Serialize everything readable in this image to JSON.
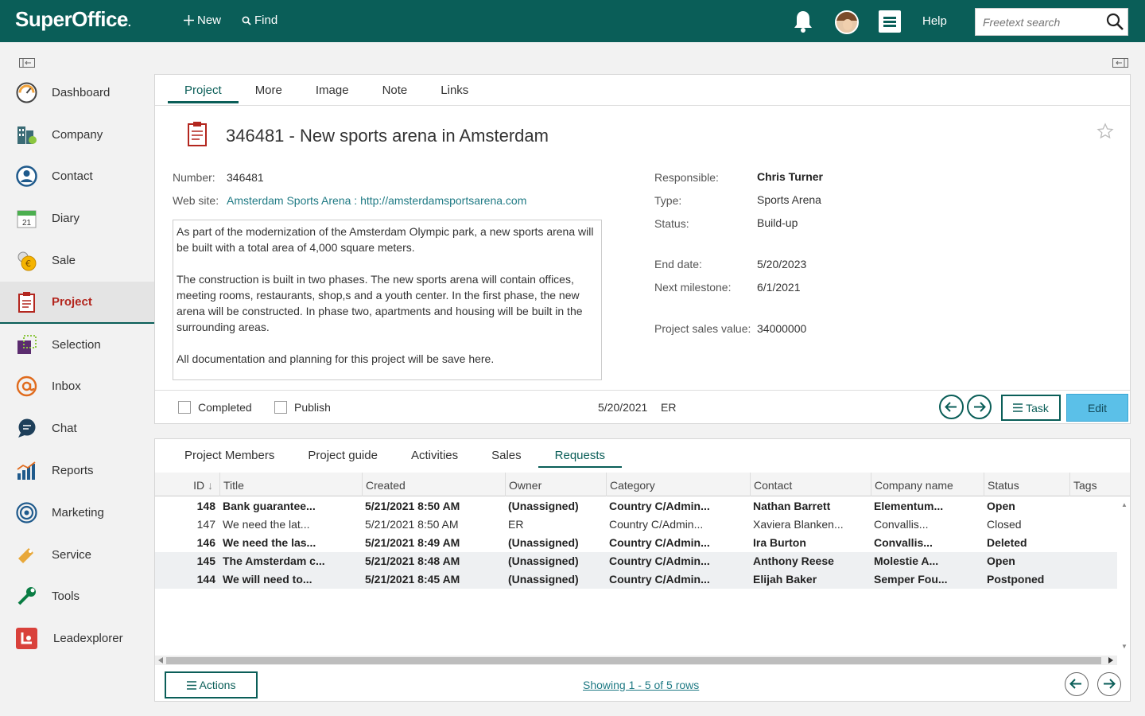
{
  "topbar": {
    "logo": "SuperOffice",
    "logo_dot": ".",
    "new_label": "New",
    "find_label": "Find",
    "help_label": "Help",
    "search_placeholder": "Freetext search",
    "brand_color": "#0a5e58"
  },
  "sidebar": {
    "items": [
      {
        "label": "Dashboard",
        "icon": "dashboard-icon"
      },
      {
        "label": "Company",
        "icon": "company-icon"
      },
      {
        "label": "Contact",
        "icon": "contact-icon"
      },
      {
        "label": "Diary",
        "icon": "diary-icon"
      },
      {
        "label": "Sale",
        "icon": "sale-icon"
      },
      {
        "label": "Project",
        "icon": "project-icon",
        "active": true
      },
      {
        "label": "Selection",
        "icon": "selection-icon"
      },
      {
        "label": "Inbox",
        "icon": "inbox-icon"
      },
      {
        "label": "Chat",
        "icon": "chat-icon"
      },
      {
        "label": "Reports",
        "icon": "reports-icon"
      },
      {
        "label": "Marketing",
        "icon": "marketing-icon"
      },
      {
        "label": "Service",
        "icon": "service-icon"
      },
      {
        "label": "Tools",
        "icon": "tools-icon"
      },
      {
        "label": "Leadexplorer",
        "icon": "leadexplorer-icon"
      }
    ],
    "diary_day": "21"
  },
  "project": {
    "tabs": [
      "Project",
      "More",
      "Image",
      "Note",
      "Links"
    ],
    "active_tab": "Project",
    "title": "346481 - New sports arena in Amsterdam",
    "number_label": "Number:",
    "number": "346481",
    "website_label": "Web site:",
    "website": "Amsterdam Sports Arena : http://amsterdamsportsarena.com",
    "description": [
      "As part of the modernization of the Amsterdam Olympic park, a new sports arena will be built with a total area of 4,000 square meters.",
      "The construction is built in two phases. The new sports arena will contain offices, meeting rooms, restaurants, shop,s and a youth center. In the first phase, the new arena will be constructed. In phase two, apartments and housing will be built in the surrounding areas.",
      "All documentation and planning for this project will be save here."
    ],
    "responsible_label": "Responsible:",
    "responsible": "Chris Turner",
    "type_label": "Type:",
    "type": "Sports Arena",
    "status_label": "Status:",
    "status": "Build-up",
    "end_date_label": "End date:",
    "end_date": "5/20/2023",
    "next_milestone_label": "Next milestone:",
    "next_milestone": "6/1/2021",
    "sales_value_label": "Project sales value:",
    "sales_value": "34000000",
    "completed_label": "Completed",
    "publish_label": "Publish",
    "footer_date": "5/20/2021",
    "footer_user": "ER",
    "task_label": "Task",
    "edit_label": "Edit"
  },
  "requests": {
    "tabs": [
      "Project Members",
      "Project guide",
      "Activities",
      "Sales",
      "Requests"
    ],
    "active_tab": "Requests",
    "columns": [
      "ID",
      "Title",
      "Created",
      "Owner",
      "Category",
      "Contact",
      "Company name",
      "Status",
      "Tags"
    ],
    "sort_indicator": "↓",
    "rows": [
      {
        "id": "148",
        "title": "Bank guarantee...",
        "created": "5/21/2021 8:50 AM",
        "owner": "(Unassigned)",
        "category": "Country C/Admin...",
        "contact": "Nathan Barrett",
        "company": "Elementum...",
        "status": "Open",
        "bold": true,
        "shade": false
      },
      {
        "id": "147",
        "title": "We need the lat...",
        "created": "5/21/2021 8:50 AM",
        "owner": "ER",
        "category": "Country C/Admin...",
        "contact": "Xaviera Blanken...",
        "company": "Convallis...",
        "status": "Closed",
        "bold": false,
        "shade": false
      },
      {
        "id": "146",
        "title": "We need the las...",
        "created": "5/21/2021 8:49 AM",
        "owner": "(Unassigned)",
        "category": "Country C/Admin...",
        "contact": "Ira Burton",
        "company": "Convallis...",
        "status": "Deleted",
        "bold": true,
        "shade": false
      },
      {
        "id": "145",
        "title": "The Amsterdam c...",
        "created": "5/21/2021 8:48 AM",
        "owner": "(Unassigned)",
        "category": "Country C/Admin...",
        "contact": "Anthony Reese",
        "company": "Molestie A...",
        "status": "Open",
        "bold": true,
        "shade": true
      },
      {
        "id": "144",
        "title": "We will need to...",
        "created": "5/21/2021 8:45 AM",
        "owner": "(Unassigned)",
        "category": "Country C/Admin...",
        "contact": "Elijah Baker",
        "company": "Semper Fou...",
        "status": "Postponed",
        "bold": true,
        "shade": true
      }
    ],
    "actions_label": "Actions",
    "showing_label": "Showing 1 - 5 of 5 rows"
  }
}
